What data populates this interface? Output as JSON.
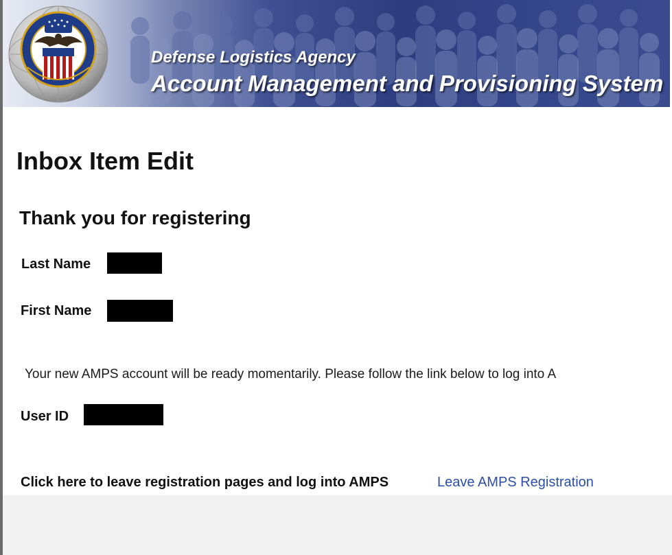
{
  "banner": {
    "agency": "Defense Logistics Agency",
    "system": "Account Management and Provisioning System",
    "seal_icon": "dla-seal-icon",
    "seal_colors": {
      "ring": "#1f3c88",
      "gold": "#d4a017",
      "red": "#b31b1b",
      "white": "#ffffff",
      "eagle": "#3a2a1a"
    }
  },
  "page": {
    "title": "Inbox Item Edit",
    "section_title": "Thank you for registering"
  },
  "fields": {
    "last_name_label": "Last Name",
    "first_name_label": "First Name",
    "user_id_label": "User ID"
  },
  "message": "Your new AMPS account will be ready momentarily. Please follow the link below to log into A",
  "cta": {
    "label": "Click here to leave registration pages and log into AMPS",
    "link": "Leave AMPS Registration",
    "link_color": "#2a4fa8"
  }
}
